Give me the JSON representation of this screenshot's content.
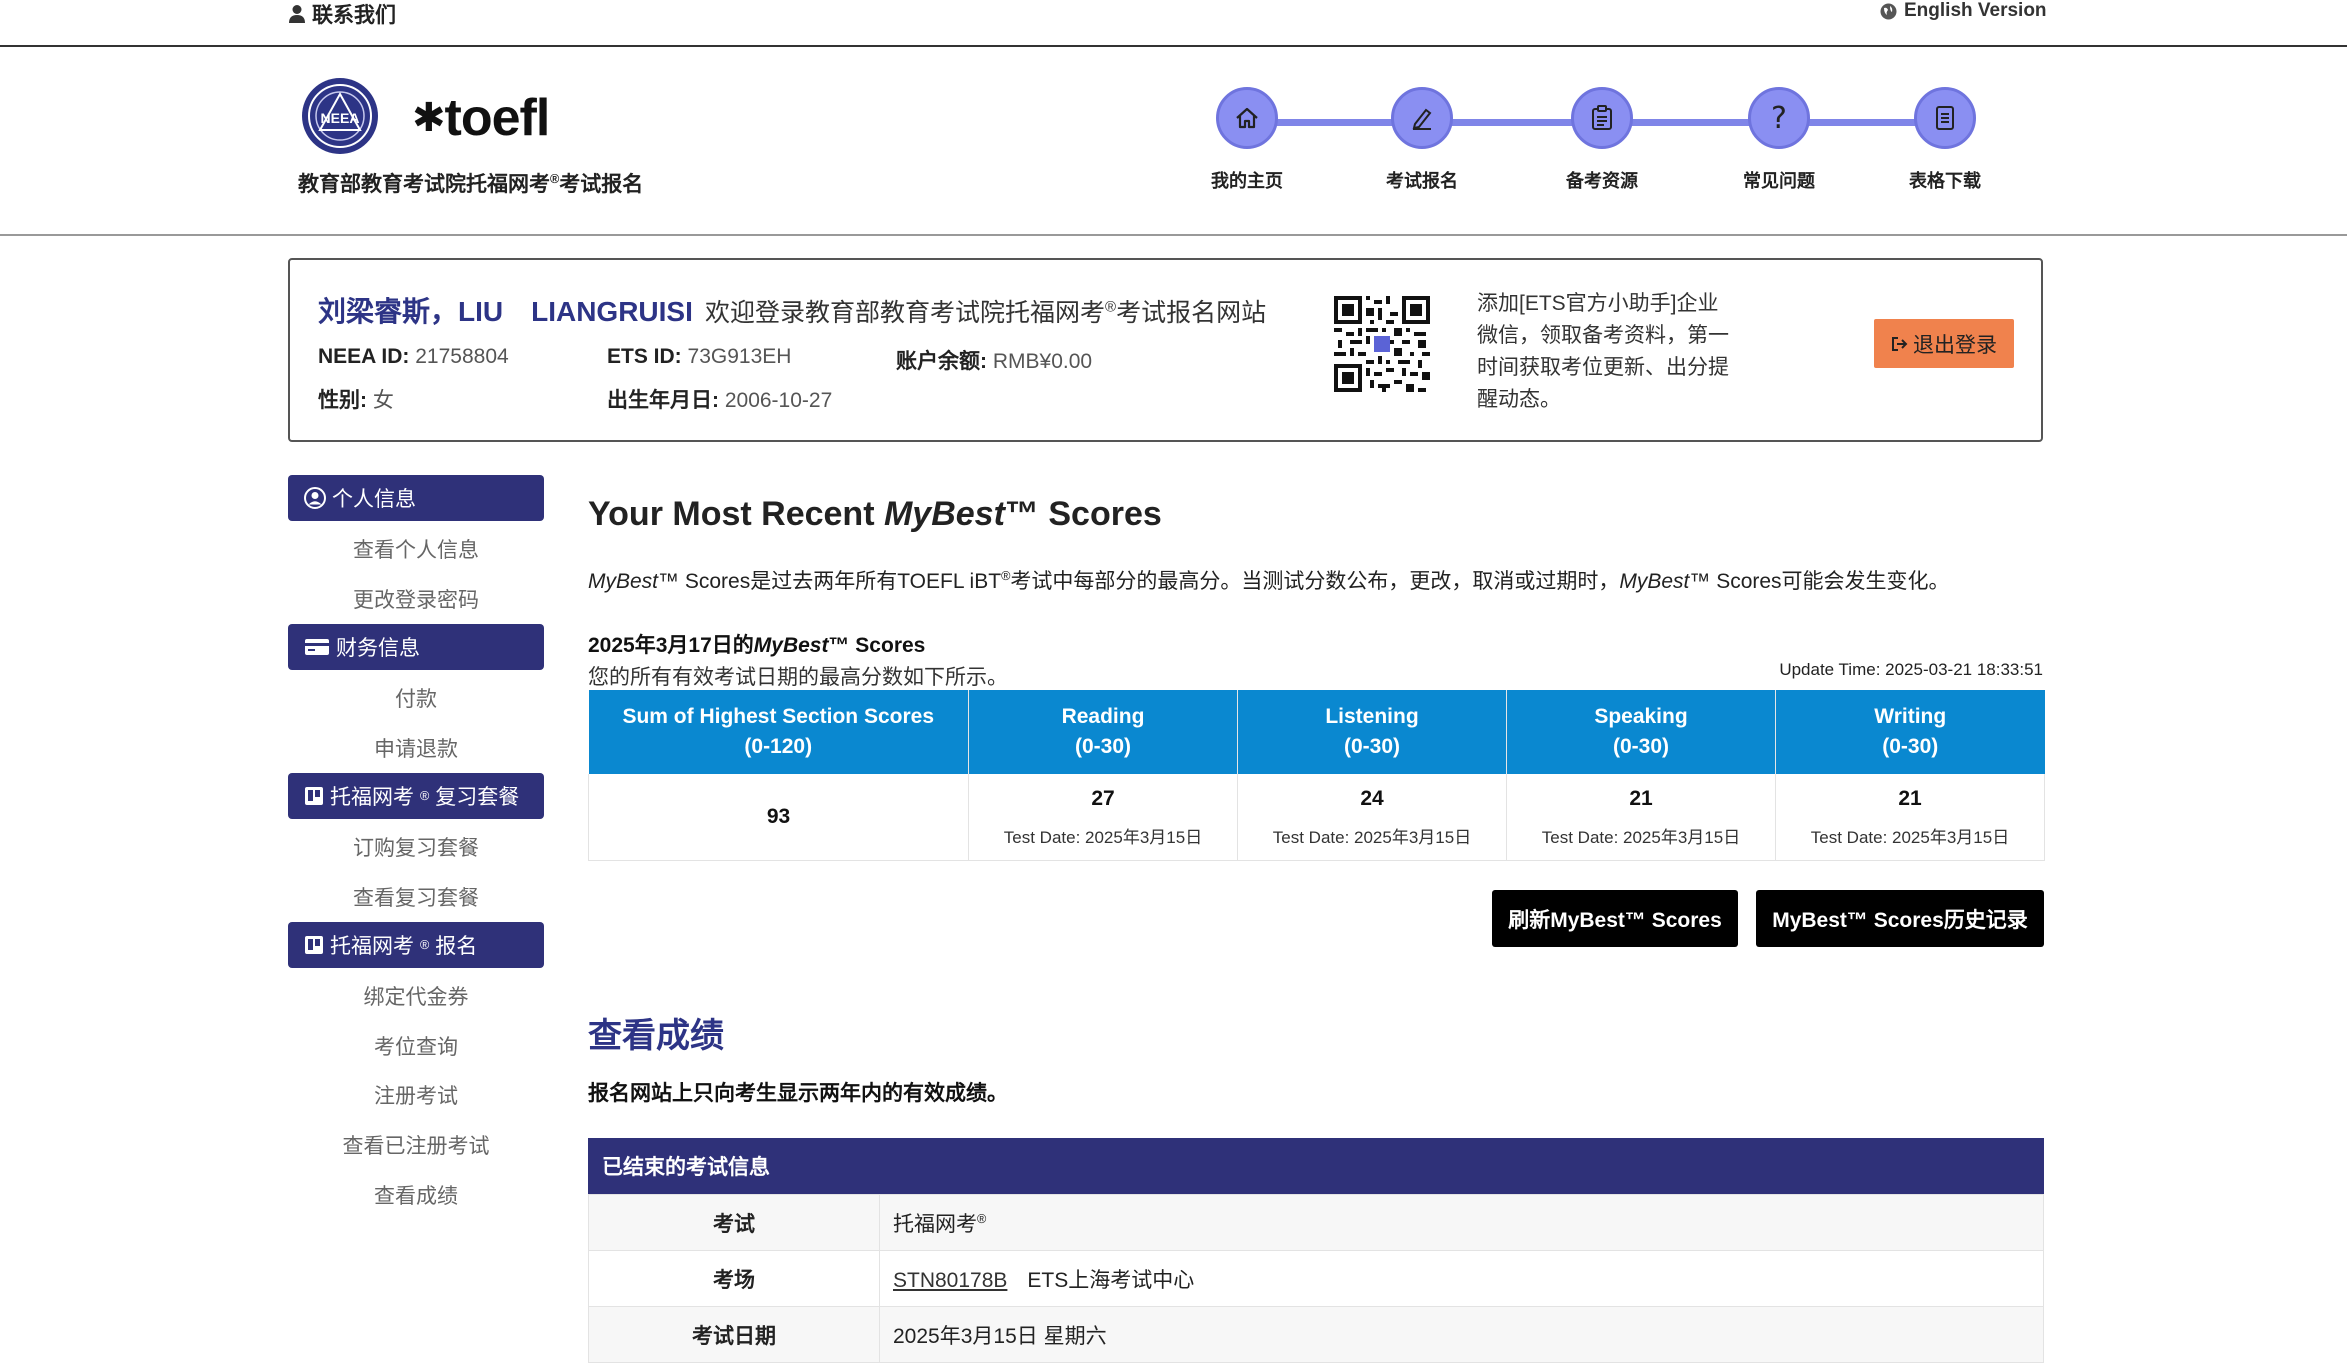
{
  "topbar": {
    "contact_label": "联系我们",
    "english_label": "English Version"
  },
  "header": {
    "logo_text": "NEEA",
    "toefl_logo": "toefl",
    "site_title": "教育部教育考试院托福网考",
    "site_title_sup": "®",
    "site_title_suffix": "考试报名",
    "nav": [
      {
        "label": "我的主页",
        "icon": "home-icon"
      },
      {
        "label": "考试报名",
        "icon": "edit-icon"
      },
      {
        "label": "备考资源",
        "icon": "clipboard-icon"
      },
      {
        "label": "常见问题",
        "icon": "question-icon"
      },
      {
        "label": "表格下载",
        "icon": "document-icon"
      }
    ]
  },
  "user": {
    "name": "刘梁睿斯，LIU　LIANGRUISI",
    "welcome_prefix": "欢迎登录教育部教育考试院托福网考",
    "welcome_sup": "®",
    "welcome_suffix": "考试报名网站",
    "neea_id_label": "NEEA ID:",
    "neea_id": "21758804",
    "ets_id_label": "ETS ID:",
    "ets_id": "73G913EH",
    "balance_label": "账户余额:",
    "balance": "RMB¥0.00",
    "gender_label": "性别:",
    "gender": "女",
    "dob_label": "出生年月日:",
    "dob": "2006-10-27",
    "wechat_text": "添加[ETS官方小助手]企业微信，领取备考资料，第一时间获取考位更新、出分提醒动态。",
    "logout_label": "退出登录"
  },
  "sidebar": {
    "sections": [
      {
        "title": "个人信息",
        "items": [
          "查看个人信息",
          "更改登录密码"
        ]
      },
      {
        "title": "财务信息",
        "items": [
          "付款",
          "申请退款"
        ]
      },
      {
        "title": "托福网考",
        "title_sup": "®",
        "title_suffix": "复习套餐",
        "items": [
          "订购复习套餐",
          "查看复习套餐"
        ]
      },
      {
        "title": "托福网考",
        "title_sup": "®",
        "title_suffix": "报名",
        "items": [
          "绑定代金券",
          "考位查询",
          "注册考试",
          "查看已注册考试",
          "查看成绩"
        ]
      }
    ]
  },
  "mybest": {
    "title_prefix": "Your Most Recent ",
    "title_em": "MyBest",
    "title_suffix": "™ Scores",
    "desc_em": "MyBest",
    "desc_1": "™ Scores是过去两年所有TOEFL iBT",
    "desc_sup": "®",
    "desc_2": "考试中每部分的最高分。当测试分数公布，更改，取消或过期时，",
    "desc_em2": "MyBest",
    "desc_3": "™ Scores可能会发生变化。",
    "date_title_prefix": "2025年3月17日的",
    "date_title_em": "MyBest",
    "date_title_suffix": "™ Scores",
    "all_valid": "您的所有有效考试日期的最高分数如下所示。",
    "update_time": "Update Time: 2025-03-21 18:33:51",
    "headers": [
      {
        "line1": "Sum of Highest Section Scores",
        "line2": "(0-120)"
      },
      {
        "line1": "Reading",
        "line2": "(0-30)"
      },
      {
        "line1": "Listening",
        "line2": "(0-30)"
      },
      {
        "line1": "Speaking",
        "line2": "(0-30)"
      },
      {
        "line1": "Writing",
        "line2": "(0-30)"
      }
    ],
    "total": "93",
    "sections": [
      {
        "score": "27",
        "date": "Test Date: 2025年3月15日"
      },
      {
        "score": "24",
        "date": "Test Date: 2025年3月15日"
      },
      {
        "score": "21",
        "date": "Test Date: 2025年3月15日"
      },
      {
        "score": "21",
        "date": "Test Date: 2025年3月15日"
      }
    ],
    "refresh_button": "刷新MyBest™ Scores",
    "history_button": "MyBest™ Scores历史记录"
  },
  "view_scores": {
    "title": "查看成绩",
    "notice": "报名网站上只向考生显示两年内的有效成绩。",
    "ended_title": "已结束的考试信息",
    "rows": [
      {
        "key": "考试",
        "value": "托福网考",
        "value_sup": "®"
      },
      {
        "key": "考场",
        "link": "STN80178B",
        "value": "ETS上海考试中心"
      },
      {
        "key": "考试日期",
        "value": "2025年3月15日 星期六"
      }
    ]
  },
  "colors": {
    "brand_navy": "#2f3179",
    "accent_blue": "#0a88d0",
    "nav_purple": "#8a8ff2",
    "logout_orange": "#f0824d"
  }
}
